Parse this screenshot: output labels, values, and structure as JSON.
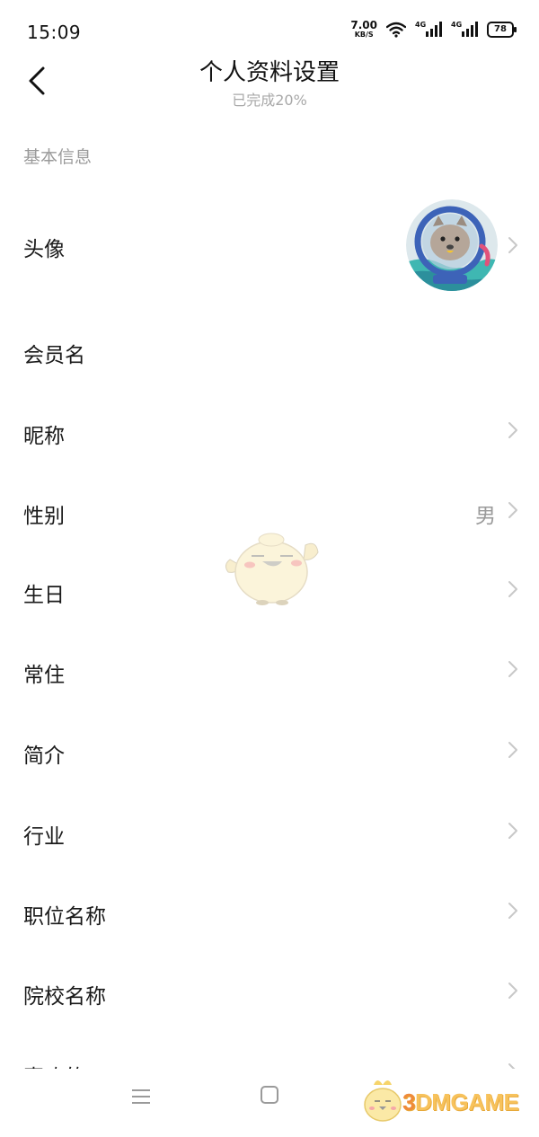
{
  "status_bar": {
    "time": "15:09",
    "net_speed_value": "7.00",
    "net_speed_unit": "KB/S",
    "sim1_label": "4G",
    "sim2_label": "4G",
    "battery": "78",
    "icons": [
      "wifi-icon",
      "signal-icon",
      "signal-icon",
      "battery-icon"
    ]
  },
  "header": {
    "title": "个人资料设置",
    "subtitle": "已完成20%",
    "back_icon": "chevron-left-icon"
  },
  "section": {
    "label": "基本信息"
  },
  "rows": [
    {
      "label": "头像",
      "value": "",
      "type": "avatar"
    },
    {
      "label": "会员名",
      "value": ""
    },
    {
      "label": "昵称",
      "value": ""
    },
    {
      "label": "性别",
      "value": "男"
    },
    {
      "label": "生日",
      "value": ""
    },
    {
      "label": "常住",
      "value": ""
    },
    {
      "label": "简介",
      "value": ""
    },
    {
      "label": "行业",
      "value": ""
    },
    {
      "label": "职位名称",
      "value": ""
    },
    {
      "label": "院校名称",
      "value": ""
    },
    {
      "label": "喜欢的",
      "value": ""
    }
  ],
  "nav_bar": {
    "icons": [
      "menu-icon",
      "home-square-icon"
    ]
  },
  "watermark": {
    "text_prefix": "3",
    "text_main": "DMGAME"
  },
  "colors": {
    "text_primary": "#1a1a1a",
    "text_secondary": "#9a9a9a",
    "chevron": "#c8c8c8",
    "background": "#ffffff",
    "watermark_yellow": "#f7c25c"
  }
}
